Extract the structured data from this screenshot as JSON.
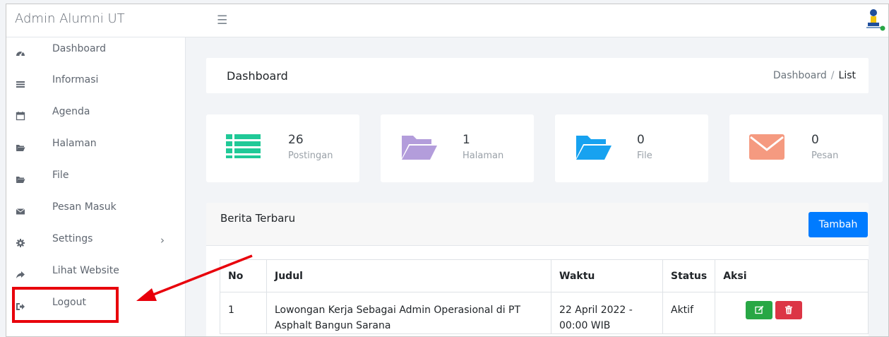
{
  "app": {
    "title": "Admin Alumni UT",
    "menu_icon": "hamburger-icon",
    "logo_icon": "ut-logo-icon"
  },
  "sidebar": {
    "items": [
      {
        "label": "Dashboard",
        "icon": "dashboard-icon"
      },
      {
        "label": "Informasi",
        "icon": "list-icon"
      },
      {
        "label": "Agenda",
        "icon": "calendar-icon"
      },
      {
        "label": "Halaman",
        "icon": "folder-icon"
      },
      {
        "label": "File",
        "icon": "folder-icon"
      },
      {
        "label": "Pesan Masuk",
        "icon": "envelope-icon"
      },
      {
        "label": "Settings",
        "icon": "gear-icon",
        "caret": "›"
      },
      {
        "label": "Lihat Website",
        "icon": "share-icon"
      },
      {
        "label": "Logout",
        "icon": "sign-out-icon"
      }
    ]
  },
  "header": {
    "title": "Dashboard",
    "breadcrumb": {
      "parent": "Dashboard",
      "separator": "/",
      "current": "List"
    }
  },
  "stats": [
    {
      "value": "26",
      "label": "Postingan",
      "icon": "list-icon",
      "color": "#20c997"
    },
    {
      "value": "1",
      "label": "Halaman",
      "icon": "folder-open-icon",
      "color": "#b39ddb"
    },
    {
      "value": "0",
      "label": "File",
      "icon": "folder-open-icon",
      "color": "#17a2f0"
    },
    {
      "value": "0",
      "label": "Pesan",
      "icon": "envelope-icon",
      "color": "#f59a80"
    }
  ],
  "news": {
    "title": "Berita Terbaru",
    "add_button": "Tambah",
    "columns": [
      "No",
      "Judul",
      "Waktu",
      "Status",
      "Aksi"
    ],
    "rows": [
      {
        "no": "1",
        "judul": "Lowongan Kerja Sebagai Admin Operasional di PT Asphalt Bangun Sarana",
        "waktu": "22 April 2022 - 00:00 WIB",
        "status": "Aktif",
        "actions": [
          {
            "icon": "edit-icon",
            "color": "#28a745"
          },
          {
            "icon": "trash-icon",
            "color": "#dc3545"
          }
        ]
      }
    ]
  },
  "annotation": {
    "highlight_color": "#e8000b"
  }
}
